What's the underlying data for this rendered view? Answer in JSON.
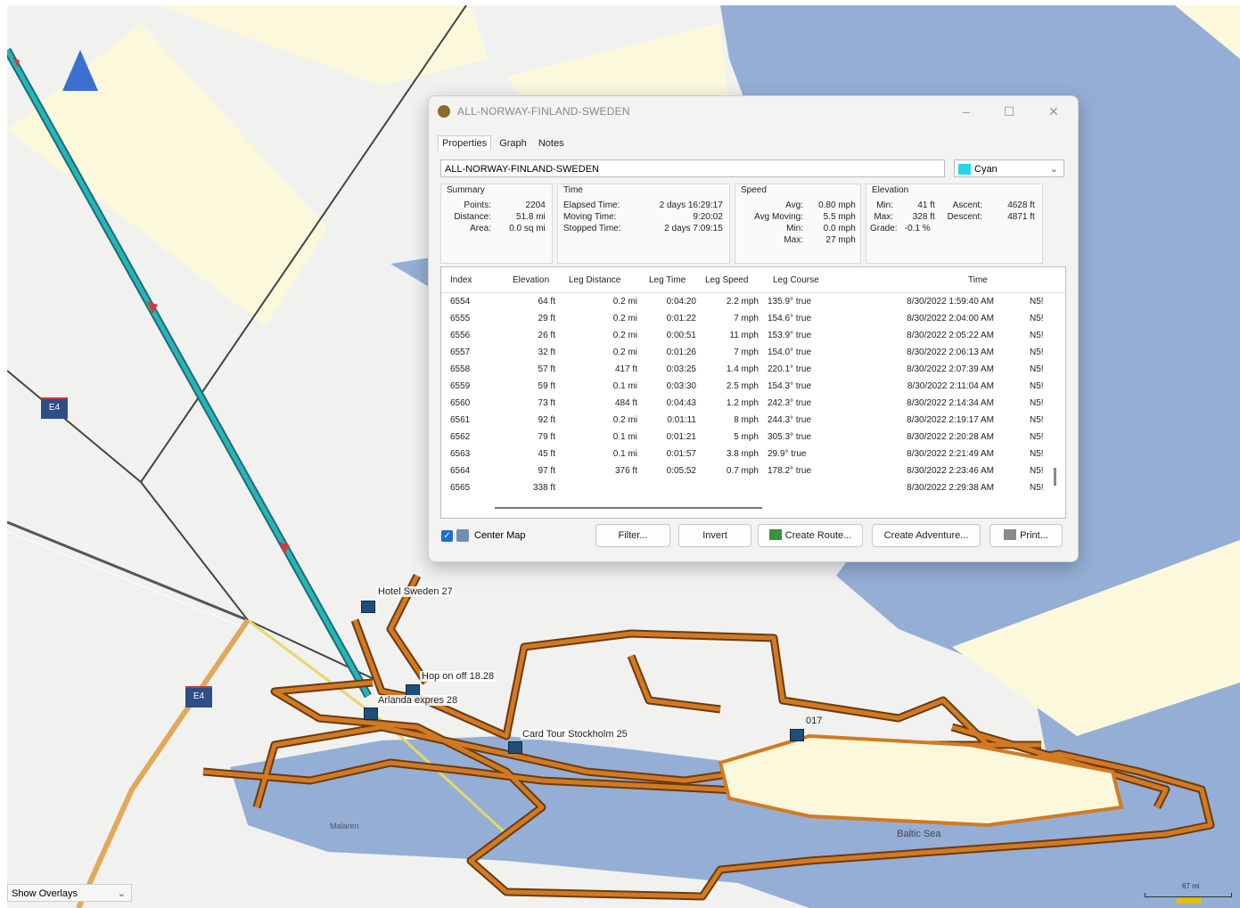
{
  "map": {
    "shields": [
      "E4",
      "E4"
    ],
    "waypoints": [
      "Hotel Sweden 27",
      "Hop on off 18.28",
      "Arlanda expres 28",
      "Card Tour Stockholm 25",
      "017"
    ],
    "water_labels": [
      "Malaren",
      "Baltic Sea"
    ],
    "overlay_select": "Show Overlays",
    "scale_label": "67 mi",
    "icons": [
      "north-arrow-icon",
      "waypoint-flag-icon",
      "route-arrow-icon"
    ],
    "colors": {
      "water": "#94aed6",
      "land": "#f1f1ef",
      "track": "#d27a22",
      "route": "#2ab3b8",
      "highway": "#e0a95a"
    }
  },
  "dialog": {
    "title": "ALL-NORWAY-FINLAND-SWEDEN",
    "window_buttons": [
      "–",
      "☐",
      "✕"
    ],
    "tabs": [
      "Properties",
      "Graph",
      "Notes"
    ],
    "name_value": "ALL-NORWAY-FINLAND-SWEDEN",
    "color": {
      "label": "Cyan",
      "hex": "#25d6e6"
    },
    "summary": {
      "title": "Summary",
      "points_label": "Points:",
      "points": "2204",
      "distance_label": "Distance:",
      "distance": "51.8 mi",
      "area_label": "Area:",
      "area": "0.0 sq mi"
    },
    "time": {
      "title": "Time",
      "elapsed_label": "Elapsed Time:",
      "elapsed": "2 days 16:29:17",
      "moving_label": "Moving Time:",
      "moving": "9:20:02",
      "stopped_label": "Stopped Time:",
      "stopped": "2 days 7:09:15"
    },
    "speed": {
      "title": "Speed",
      "avg_label": "Avg:",
      "avg": "0.80 mph",
      "avg_moving_label": "Avg Moving:",
      "avg_moving": "5.5 mph",
      "min_label": "Min:",
      "min": "0.0 mph",
      "max_label": "Max:",
      "max": "27 mph"
    },
    "elevation": {
      "title": "Elevation",
      "min_label": "Min:",
      "min": "41 ft",
      "max_label": "Max:",
      "max": "328 ft",
      "grade_label": "Grade:",
      "grade": "-0.1 %",
      "ascent_label": "Ascent:",
      "ascent": "4628 ft",
      "descent_label": "Descent:",
      "descent": "4871 ft"
    },
    "columns": [
      "Index",
      "Elevation",
      "Leg Distance",
      "Leg Time",
      "Leg Speed",
      "Leg Course",
      "Time",
      ""
    ],
    "rows": [
      [
        "6554",
        "64 ft",
        "0.2 mi",
        "0:04:20",
        "2.2 mph",
        "135.9° true",
        "8/30/2022 1:59:40 AM",
        "N5!"
      ],
      [
        "6555",
        "29 ft",
        "0.2 mi",
        "0:01:22",
        "7 mph",
        "154.6° true",
        "8/30/2022 2:04:00 AM",
        "N5!"
      ],
      [
        "6556",
        "26 ft",
        "0.2 mi",
        "0:00:51",
        "11 mph",
        "153.9° true",
        "8/30/2022 2:05:22 AM",
        "N5!"
      ],
      [
        "6557",
        "32 ft",
        "0.2 mi",
        "0:01:26",
        "7 mph",
        "154.0° true",
        "8/30/2022 2:06:13 AM",
        "N5!"
      ],
      [
        "6558",
        "57 ft",
        "417 ft",
        "0:03:25",
        "1.4 mph",
        "220.1° true",
        "8/30/2022 2:07:39 AM",
        "N5!"
      ],
      [
        "6559",
        "59 ft",
        "0.1 mi",
        "0:03:30",
        "2.5 mph",
        "154.3° true",
        "8/30/2022 2:11:04 AM",
        "N5!"
      ],
      [
        "6560",
        "73 ft",
        "484 ft",
        "0:04:43",
        "1.2 mph",
        "242.3° true",
        "8/30/2022 2:14:34 AM",
        "N5!"
      ],
      [
        "6561",
        "92 ft",
        "0.2 mi",
        "0:01:11",
        "8 mph",
        "244.3° true",
        "8/30/2022 2:19:17 AM",
        "N5!"
      ],
      [
        "6562",
        "79 ft",
        "0.1 mi",
        "0:01:21",
        "5 mph",
        "305.3° true",
        "8/30/2022 2:20:28 AM",
        "N5!"
      ],
      [
        "6563",
        "45 ft",
        "0.1 mi",
        "0:01:57",
        "3.8 mph",
        "29.9° true",
        "8/30/2022 2:21:49 AM",
        "N5!"
      ],
      [
        "6564",
        "97 ft",
        "376 ft",
        "0:05:52",
        "0.7 mph",
        "178.2° true",
        "8/30/2022 2:23:46 AM",
        "N5!"
      ],
      [
        "6565",
        "338 ft",
        "",
        "",
        "",
        "",
        "8/30/2022 2:29:38 AM",
        "N5!"
      ]
    ],
    "center_map_checked": true,
    "center_map_label": "Center Map",
    "buttons": {
      "filter": "Filter...",
      "invert": "Invert",
      "create_route": "Create Route...",
      "create_adventure": "Create Adventure...",
      "print": "Print..."
    }
  }
}
